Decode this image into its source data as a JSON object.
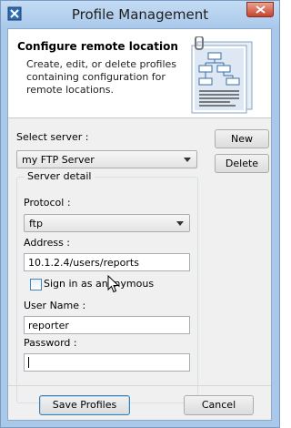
{
  "window": {
    "title": "Profile Management"
  },
  "header": {
    "title": "Configure remote location",
    "description": "Create, edit, or delete profiles containing configuration for remote locations."
  },
  "server": {
    "label": "Select server :",
    "selected": "my FTP Server",
    "new_label": "New",
    "delete_label": "Delete"
  },
  "detail": {
    "group_label": "Server detail",
    "protocol_label": "Protocol :",
    "protocol_value": "ftp",
    "address_label": "Address :",
    "address_value": "10.1.2.4/users/reports",
    "anonymous_label": "Sign in as anonymous",
    "anonymous_checked": false,
    "username_label": "User Name :",
    "username_value": "reporter",
    "password_label": "Password :",
    "password_value": ""
  },
  "footer": {
    "save_label": "Save Profiles",
    "cancel_label": "Cancel"
  }
}
